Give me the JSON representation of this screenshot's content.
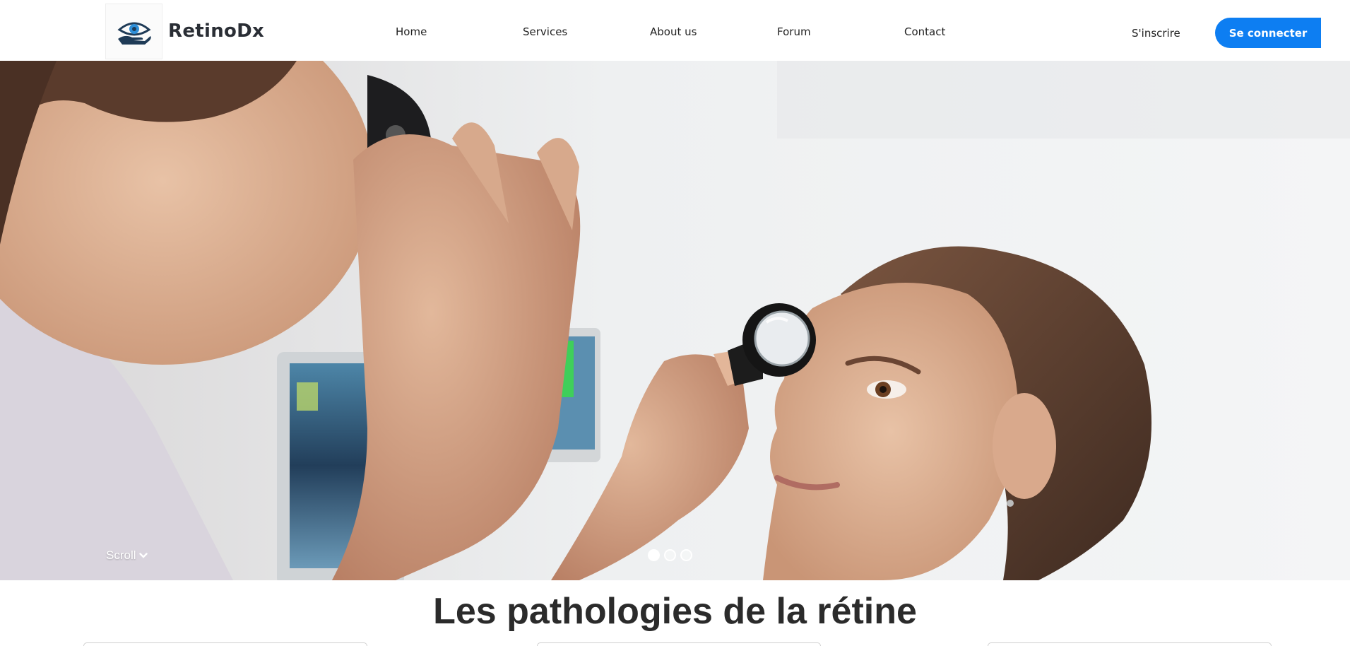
{
  "brand": {
    "name": "RetinoDx",
    "logo_icon": "eye-in-hand-icon"
  },
  "nav": {
    "home": "Home",
    "services": "Services",
    "about": "About us",
    "forum": "Forum",
    "contact": "Contact"
  },
  "auth": {
    "signup": "S'inscrire",
    "login": "Se connecter"
  },
  "hero": {
    "scroll_label": "Scroll",
    "scroll_icon": "chevron-down-icon",
    "slide_count": 3,
    "active_slide": 1
  },
  "section": {
    "title": "Les pathologies de la rétine"
  },
  "colors": {
    "primary": "#0d7ef2",
    "logo_dark": "#1f3b57",
    "logo_accent": "#2f8fd8"
  }
}
